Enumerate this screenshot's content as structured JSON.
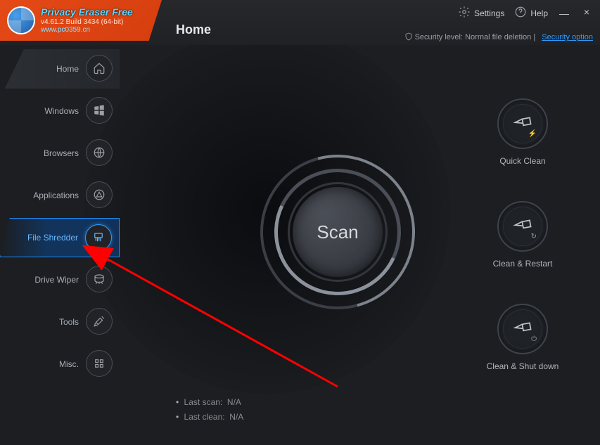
{
  "app": {
    "title": "Privacy Eraser Free",
    "version_line": "v4.61.2 Build 3434 (64-bit)",
    "watermark_url": "www.pc0359.cn"
  },
  "header": {
    "page_title": "Home",
    "settings_label": "Settings",
    "help_label": "Help",
    "security_prefix": "Security level: ",
    "security_level": "Normal file deletion",
    "security_link": "Security option"
  },
  "sidebar": {
    "items": [
      {
        "label": "Home"
      },
      {
        "label": "Windows"
      },
      {
        "label": "Browsers"
      },
      {
        "label": "Applications"
      },
      {
        "label": "File Shredder"
      },
      {
        "label": "Drive Wiper"
      },
      {
        "label": "Tools"
      },
      {
        "label": "Misc."
      }
    ],
    "active_index": 4
  },
  "center": {
    "scan_label": "Scan"
  },
  "actions": {
    "quick_clean": "Quick Clean",
    "clean_restart": "Clean & Restart",
    "clean_shutdown": "Clean & Shut down"
  },
  "status": {
    "last_scan_label": "Last scan:",
    "last_scan_value": "N/A",
    "last_clean_label": "Last clean:",
    "last_clean_value": "N/A"
  }
}
